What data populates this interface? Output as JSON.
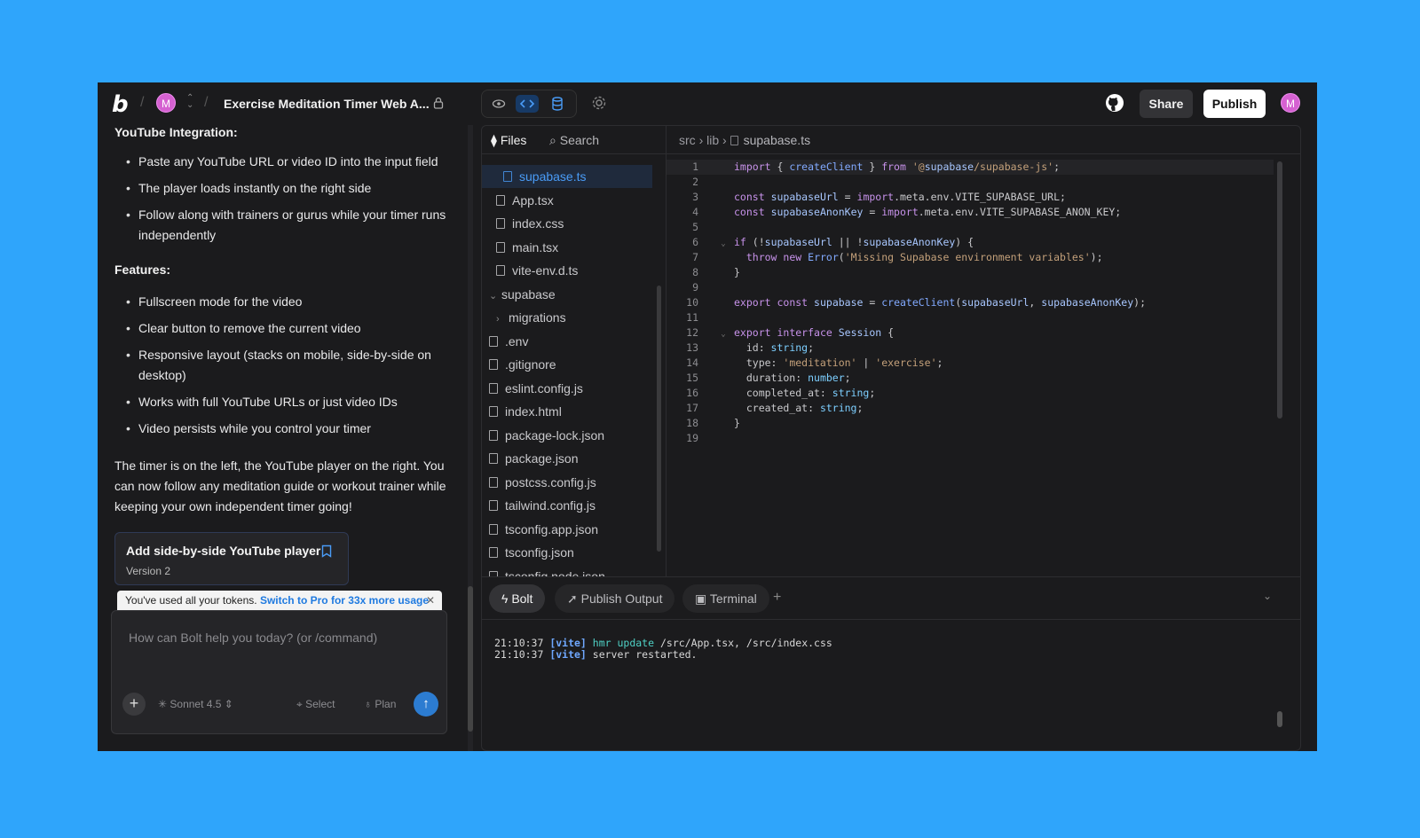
{
  "header": {
    "logo": "b",
    "project_avatar": "M",
    "project_title": "Exercise Meditation Timer Web A...",
    "share_label": "Share",
    "publish_label": "Publish",
    "user_avatar": "M"
  },
  "chat": {
    "section1_title": "YouTube Integration:",
    "section1_items": [
      "Paste any YouTube URL or video ID into the input field",
      "The player loads instantly on the right side",
      "Follow along with trainers or gurus while your timer runs independently"
    ],
    "section2_title": "Features:",
    "section2_items": [
      "Fullscreen mode for the video",
      "Clear button to remove the current video",
      "Responsive layout (stacks on mobile, side-by-side on desktop)",
      "Works with full YouTube URLs or just video IDs",
      "Video persists while you control your timer"
    ],
    "summary": "The timer is on the left, the YouTube player on the right. You can now follow any meditation guide or workout trainer while keeping your own independent timer going!",
    "version_title": "Add side-by-side YouTube player",
    "version_label": "Version 2",
    "token_notice": "You've used all your tokens.",
    "token_link": "Switch to Pro for 33x more usage",
    "prompt_placeholder": "How can Bolt help you today? (or /command)",
    "model": "Sonnet 4.5",
    "select_label": "Select",
    "plan_label": "Plan"
  },
  "workbench": {
    "files_tab": "Files",
    "search_tab": "Search",
    "breadcrumb": [
      "src",
      "lib",
      "supabase.ts"
    ],
    "tree": [
      {
        "name": "supabase.ts",
        "type": "file",
        "indent": 2,
        "active": true
      },
      {
        "name": "App.tsx",
        "type": "file",
        "indent": 1
      },
      {
        "name": "index.css",
        "type": "file",
        "indent": 1
      },
      {
        "name": "main.tsx",
        "type": "file",
        "indent": 1
      },
      {
        "name": "vite-env.d.ts",
        "type": "file",
        "indent": 1
      },
      {
        "name": "supabase",
        "type": "folder-open",
        "indent": 0
      },
      {
        "name": "migrations",
        "type": "folder",
        "indent": 1
      },
      {
        "name": ".env",
        "type": "file",
        "indent": 0
      },
      {
        "name": ".gitignore",
        "type": "file",
        "indent": 0
      },
      {
        "name": "eslint.config.js",
        "type": "file",
        "indent": 0
      },
      {
        "name": "index.html",
        "type": "file",
        "indent": 0
      },
      {
        "name": "package-lock.json",
        "type": "file",
        "indent": 0
      },
      {
        "name": "package.json",
        "type": "file",
        "indent": 0
      },
      {
        "name": "postcss.config.js",
        "type": "file",
        "indent": 0
      },
      {
        "name": "tailwind.config.js",
        "type": "file",
        "indent": 0
      },
      {
        "name": "tsconfig.app.json",
        "type": "file",
        "indent": 0
      },
      {
        "name": "tsconfig.json",
        "type": "file",
        "indent": 0
      },
      {
        "name": "tsconfig.node.json",
        "type": "file",
        "indent": 0
      }
    ],
    "code": [
      "import { createClient } from '@supabase/supabase-js';",
      "",
      "const supabaseUrl = import.meta.env.VITE_SUPABASE_URL;",
      "const supabaseAnonKey = import.meta.env.VITE_SUPABASE_ANON_KEY;",
      "",
      "if (!supabaseUrl || !supabaseAnonKey) {",
      "  throw new Error('Missing Supabase environment variables');",
      "}",
      "",
      "export const supabase = createClient(supabaseUrl, supabaseAnonKey);",
      "",
      "export interface Session {",
      "  id: string;",
      "  type: 'meditation' | 'exercise';",
      "  duration: number;",
      "  completed_at: string;",
      "  created_at: string;",
      "}",
      ""
    ],
    "bottom_tabs": [
      "Bolt",
      "Publish Output",
      "Terminal"
    ],
    "terminal": [
      {
        "time": "21:10:37",
        "tag": "[vite]",
        "event": "hmr update",
        "rest": " /src/App.tsx, /src/index.css"
      },
      {
        "time": "21:10:37",
        "tag": "[vite]",
        "event": "",
        "rest": "server restarted."
      }
    ]
  }
}
